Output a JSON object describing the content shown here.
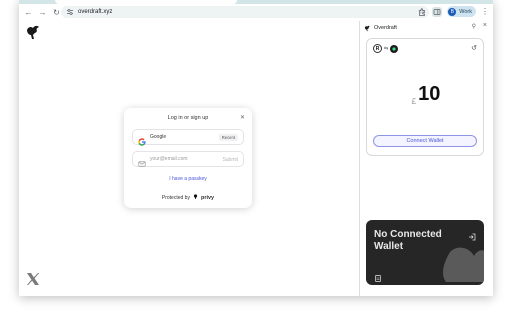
{
  "browser": {
    "url": "overdraft.xyz",
    "profile_name": "Work",
    "profile_initial": "B"
  },
  "modal": {
    "title": "Log in or sign up",
    "google_label": "Google",
    "google_badge": "Recent",
    "email_placeholder": "your@email.com",
    "submit_label": "Submit",
    "passkey_label": "I have a passkey",
    "protected_by": "Protected by",
    "brand": "privy"
  },
  "sidepanel": {
    "title": "Overdraft",
    "token_letter": "R",
    "swap_glyph": "⇆",
    "currency": "£",
    "amount": "10",
    "connect_label": "Connect Wallet",
    "no_wallet_label": "No Connected Wallet"
  },
  "colors": {
    "accent": "#4b54d8",
    "tabstrip": "#d3e6e7",
    "card_dark": "#262626"
  }
}
